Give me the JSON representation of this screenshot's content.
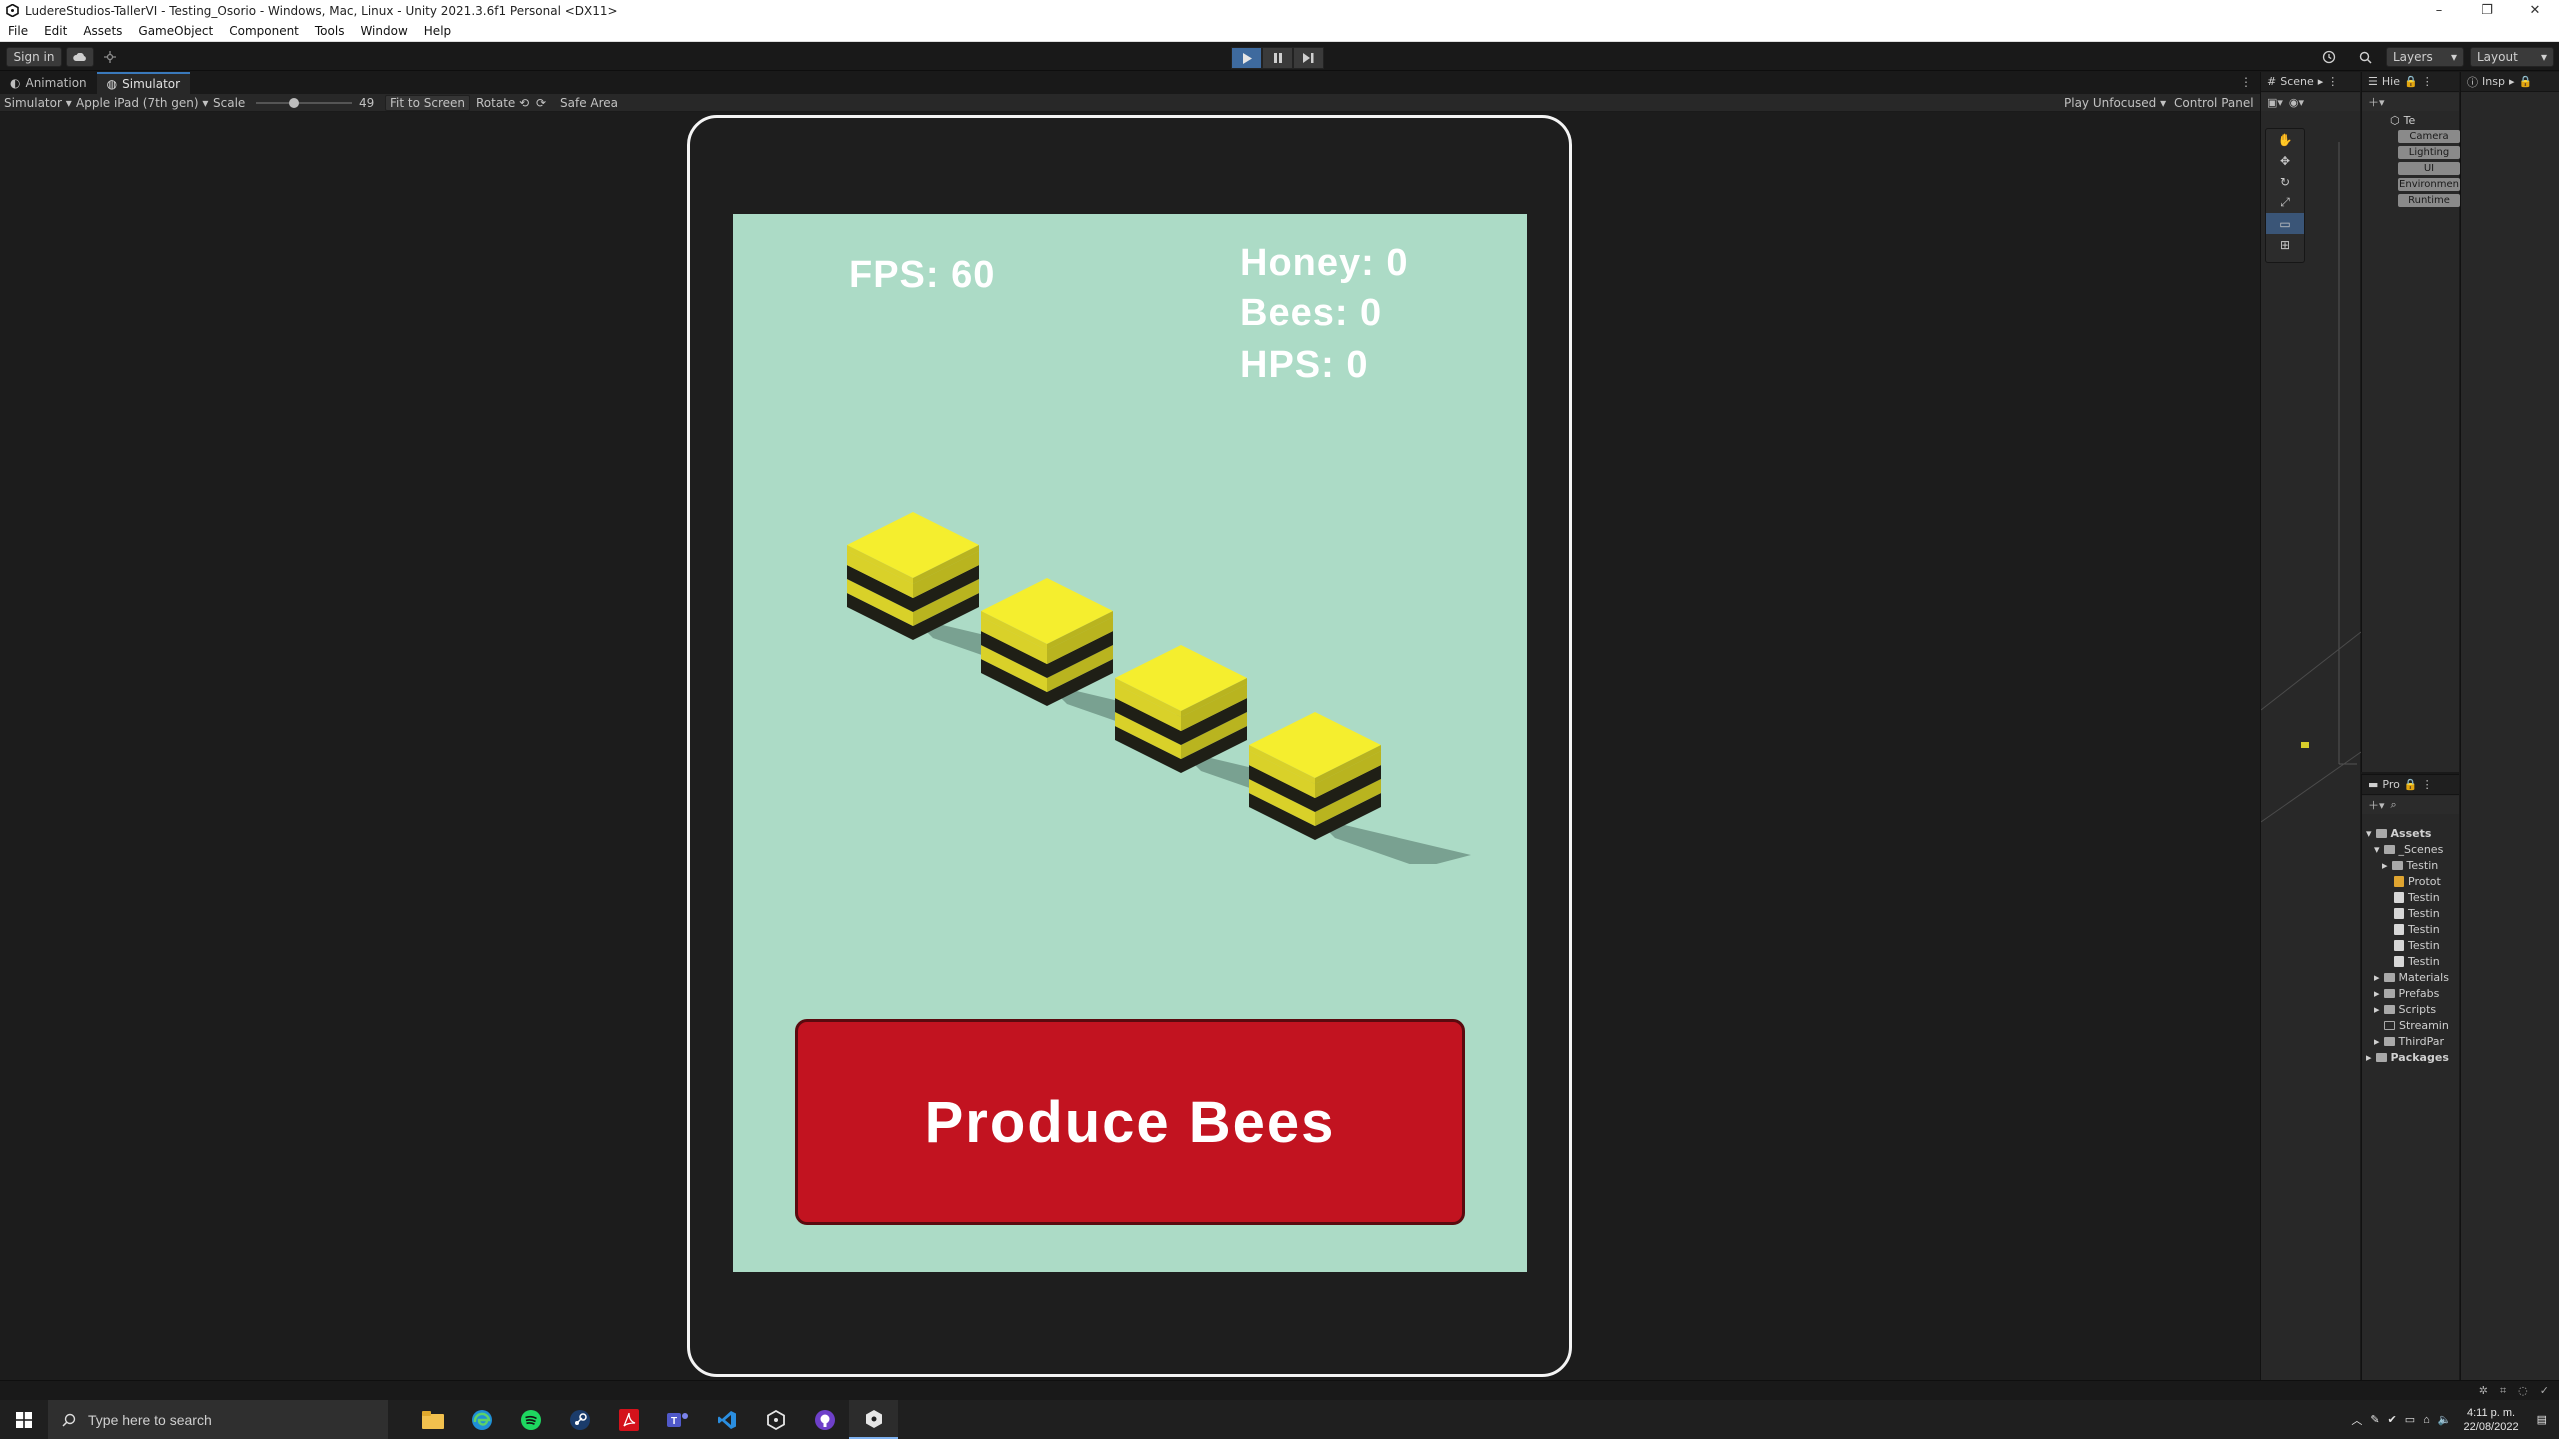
{
  "window": {
    "title": "LudereStudios-TallerVI - Testing_Osorio - Windows, Mac, Linux - Unity 2021.3.6f1 Personal <DX11>",
    "controls": [
      "–",
      "❐",
      "✕"
    ]
  },
  "menu": [
    "File",
    "Edit",
    "Assets",
    "GameObject",
    "Component",
    "Tools",
    "Window",
    "Help"
  ],
  "toolbar": {
    "sign_in": "Sign in",
    "layers": "Layers",
    "layout": "Layout"
  },
  "tabs": {
    "animation": "Animation",
    "simulator": "Simulator"
  },
  "sim_toolbar": {
    "mode": "Simulator",
    "device": "Apple iPad (7th gen)",
    "scale_label": "Scale",
    "scale_value": "49",
    "fit_to_screen": "Fit to Screen",
    "rotate": "Rotate",
    "safe_area": "Safe Area",
    "play_mode": "Play Unfocused",
    "control_panel": "Control Panel"
  },
  "game": {
    "fps": "FPS: 60",
    "honey": "Honey: 0",
    "bees": "Bees: 0",
    "hps": "HPS: 0",
    "produce_button": "Produce Bees",
    "button_color": "#c21320",
    "background_color": "#acdbc6",
    "hive_color": "#e6de2a"
  },
  "scene_panel": {
    "tab": "Scene"
  },
  "hierarchy": {
    "tab": "Hie",
    "root": "Te",
    "items": [
      "Camera",
      "Lighting",
      "UI",
      "Environmen",
      "Runtime"
    ]
  },
  "inspector": {
    "tab": "Insp"
  },
  "project": {
    "tab": "Pro",
    "tree": {
      "assets": "Assets",
      "scenes": "_Scenes",
      "scene_children": [
        "Testin",
        "Protot",
        "Testin",
        "Testin",
        "Testin",
        "Testin",
        "Testin"
      ],
      "folders": [
        "Materials",
        "Prefabs",
        "Scripts",
        "Streamin",
        "ThirdPar"
      ],
      "packages": "Packages"
    }
  },
  "taskbar": {
    "search_placeholder": "Type here to search",
    "time": "4:11 p. m.",
    "date": "22/08/2022"
  }
}
